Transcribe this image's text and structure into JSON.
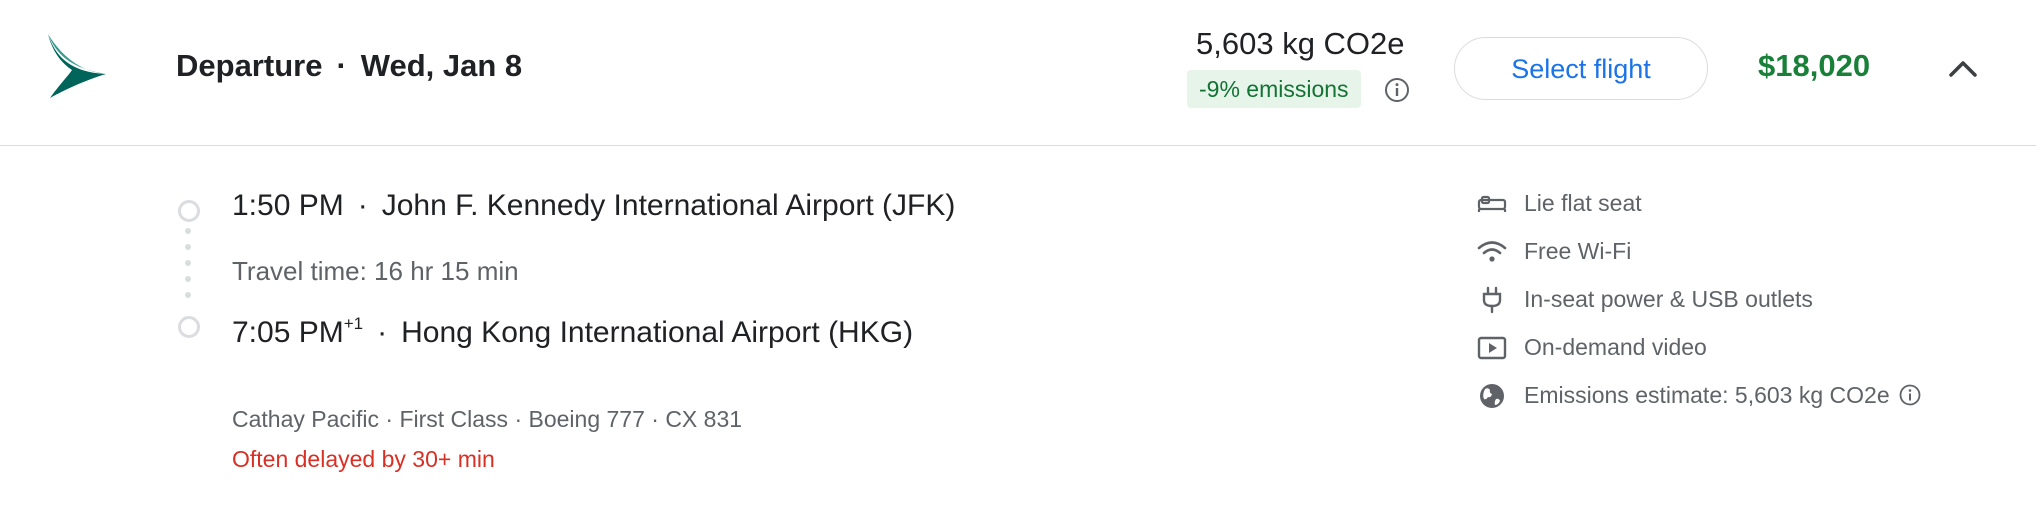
{
  "header": {
    "direction": "Departure",
    "separator": "·",
    "date": "Wed, Jan 8",
    "emissions_value": "5,603 kg CO2e",
    "emissions_badge": "-9% emissions",
    "select_label": "Select flight",
    "price": "$18,020",
    "colors": {
      "price": "#188038",
      "badge_bg": "#e6f4ea",
      "badge_text": "#137333",
      "button_text": "#1a73e8"
    }
  },
  "segment": {
    "departure_time": "1:50 PM",
    "departure_airport": "John F. Kennedy International Airport (JFK)",
    "travel_time": "Travel time: 16 hr 15 min",
    "arrival_time": "7:05 PM",
    "arrival_day_offset": "+1",
    "arrival_airport": "Hong Kong International Airport (HKG)",
    "sep": "·",
    "details": "Cathay Pacific · First Class · Boeing 777 · CX 831",
    "delay_warning": "Often delayed by 30+ min",
    "delay_color": "#d93025"
  },
  "amenities": [
    {
      "icon": "bed-icon",
      "label": "Lie flat seat"
    },
    {
      "icon": "wifi-icon",
      "label": "Free Wi-Fi"
    },
    {
      "icon": "power-plug-icon",
      "label": "In-seat power & USB outlets"
    },
    {
      "icon": "video-icon",
      "label": "On-demand video"
    },
    {
      "icon": "globe-icon",
      "label": "Emissions estimate: 5,603 kg CO2e"
    }
  ]
}
